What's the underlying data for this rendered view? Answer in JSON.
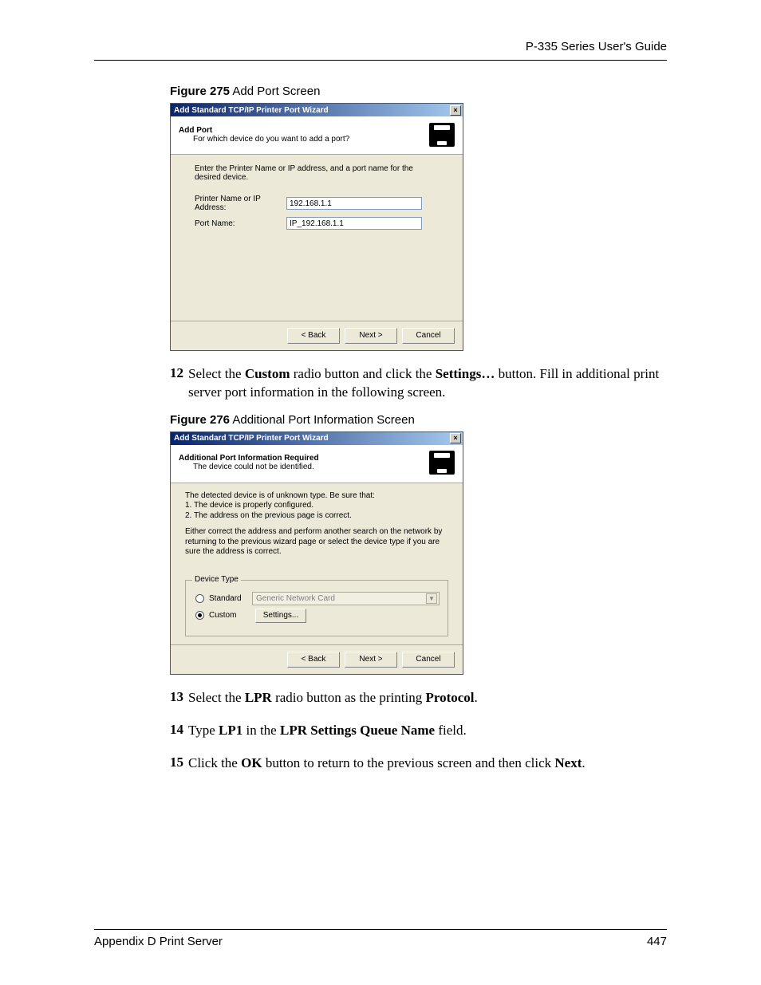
{
  "header": {
    "right": "P-335 Series User's Guide"
  },
  "fig275": {
    "caption_bold": "Figure 275",
    "caption_rest": "   Add Port Screen",
    "title": "Add Standard TCP/IP Printer Port Wizard",
    "banner_bold": "Add Port",
    "banner_sub": "For which device do you want to add a port?",
    "instruction": "Enter the Printer Name or IP address, and a port name for the desired device.",
    "label_ip": "Printer Name or IP Address:",
    "value_ip": "192.168.1.1",
    "label_port": "Port Name:",
    "value_port": "IP_192.168.1.1",
    "back": "< Back",
    "next": "Next >",
    "cancel": "Cancel"
  },
  "step12": {
    "num": "12",
    "text_pre": "Select the ",
    "b1": "Custom",
    "mid1": " radio button and click the ",
    "b2": "Settings…",
    "mid2": " button. Fill in additional print server port information in the following screen."
  },
  "fig276": {
    "caption_bold": "Figure 276",
    "caption_rest": "   Additional Port Information Screen",
    "title": "Add Standard TCP/IP Printer Port Wizard",
    "banner_bold": "Additional Port Information Required",
    "banner_sub": "The device could not be identified.",
    "para1": "The detected device is of unknown type.  Be sure that:",
    "para1a": "1. The device is properly configured.",
    "para1b": "2.  The address on the previous page is correct.",
    "para2": "Either correct the address and perform another search on the network by returning to the previous wizard page or select the device type if you are sure the address is correct.",
    "legend": "Device Type",
    "radio_std": "Standard",
    "combo_text": "Generic Network Card",
    "radio_custom": "Custom",
    "settings_btn": "Settings...",
    "back": "< Back",
    "next": "Next >",
    "cancel": "Cancel"
  },
  "step13": {
    "num": "13",
    "pre": "Select the ",
    "b1": "LPR",
    "mid": " radio button as the printing ",
    "b2": "Protocol",
    "post": "."
  },
  "step14": {
    "num": "14",
    "pre": "Type ",
    "b1": "LP1",
    "mid": " in the ",
    "b2": "LPR Settings Queue Name",
    "post": " field."
  },
  "step15": {
    "num": "15",
    "pre": "Click the ",
    "b1": "OK",
    "mid": " button to return to the previous screen and then click ",
    "b2": "Next",
    "post": "."
  },
  "footer": {
    "left": "Appendix D Print Server",
    "right": "447"
  }
}
